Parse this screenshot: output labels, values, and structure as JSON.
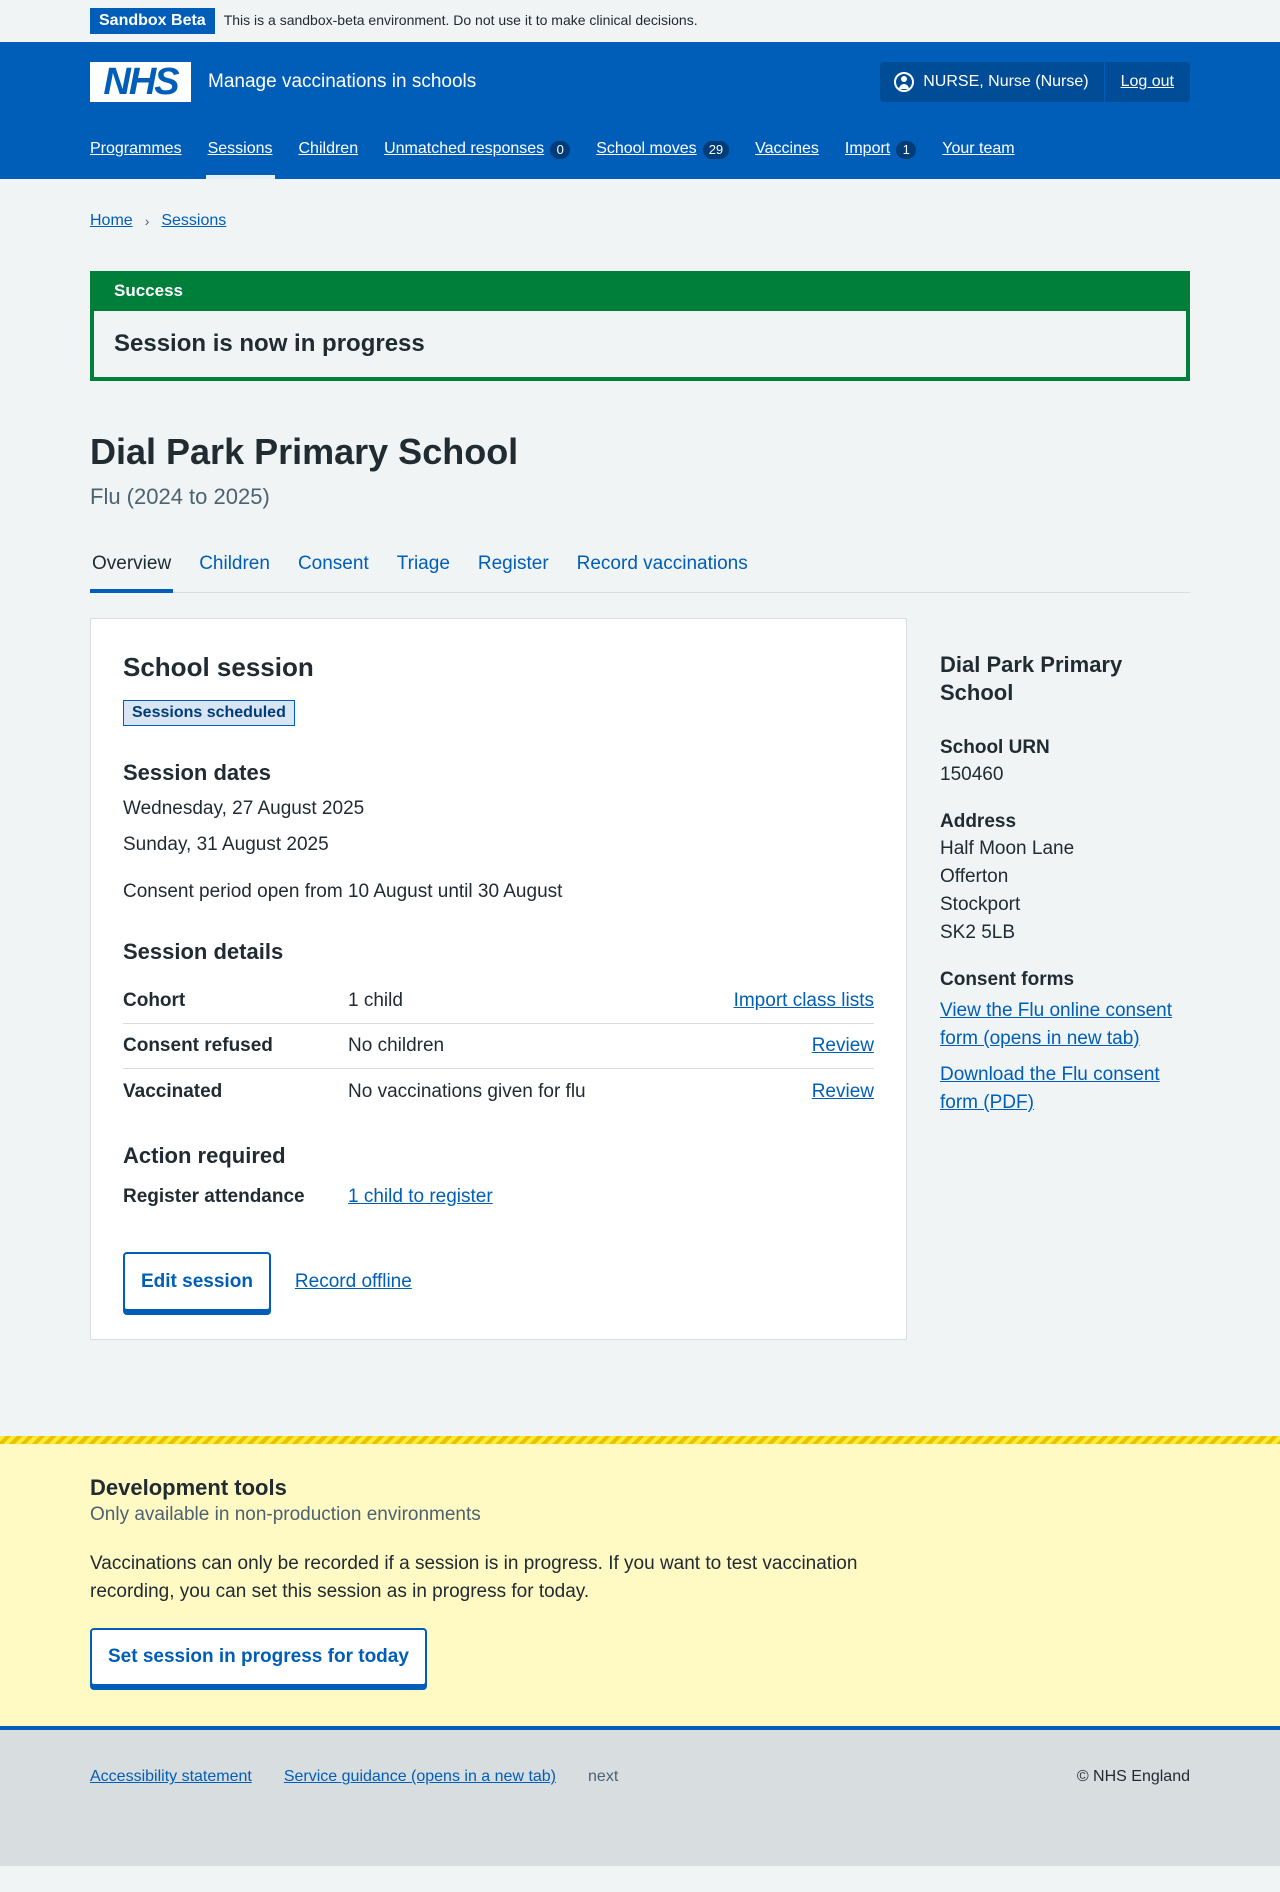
{
  "sandbox": {
    "tag": "Sandbox Beta",
    "message": "This is a sandbox-beta environment. Do not use it to make clinical decisions."
  },
  "header": {
    "logo_text": "NHS",
    "service_name": "Manage vaccinations in schools",
    "user": "NURSE, Nurse (Nurse)",
    "logout": "Log out"
  },
  "nav": [
    {
      "label": "Programmes",
      "count": null
    },
    {
      "label": "Sessions",
      "count": null,
      "active": true
    },
    {
      "label": "Children",
      "count": null
    },
    {
      "label": "Unmatched responses",
      "count": "0"
    },
    {
      "label": "School moves",
      "count": "29"
    },
    {
      "label": "Vaccines",
      "count": null
    },
    {
      "label": "Import",
      "count": "1"
    },
    {
      "label": "Your team",
      "count": null
    }
  ],
  "breadcrumb": [
    "Home",
    "Sessions"
  ],
  "success": {
    "title": "Success",
    "message": "Session is now in progress"
  },
  "page": {
    "title": "Dial Park Primary School",
    "caption": "Flu (2024 to 2025)"
  },
  "tabs": [
    "Overview",
    "Children",
    "Consent",
    "Triage",
    "Register",
    "Record vaccinations"
  ],
  "card": {
    "heading": "School session",
    "status_tag": "Sessions scheduled",
    "dates_heading": "Session dates",
    "dates": [
      "Wednesday, 27 August 2025",
      "Sunday, 31 August 2025"
    ],
    "consent_period": "Consent period open from 10 August until 30 August",
    "details_heading": "Session details",
    "details": [
      {
        "key": "Cohort",
        "value": "1 child",
        "action": "Import class lists"
      },
      {
        "key": "Consent refused",
        "value": "No children",
        "action": "Review"
      },
      {
        "key": "Vaccinated",
        "value": "No vaccinations given for flu",
        "action": "Review"
      }
    ],
    "action_heading": "Action required",
    "action_key": "Register attendance",
    "action_link": "1 child to register",
    "edit_button": "Edit session",
    "offline_link": "Record offline"
  },
  "aside": {
    "heading": "Dial Park Primary School",
    "urn_label": "School URN",
    "urn": "150460",
    "address_label": "Address",
    "address": [
      "Half Moon Lane",
      "Offerton",
      "Stockport",
      "SK2 5LB"
    ],
    "consent_label": "Consent forms",
    "links": [
      "View the Flu online consent form (opens in new tab)",
      "Download the Flu consent form (PDF)"
    ]
  },
  "devtools": {
    "heading": "Development tools",
    "sub": "Only available in non-production environments",
    "description": "Vaccinations can only be recorded if a session is in progress. If you want to test vaccination recording, you can set this session as in progress for today.",
    "button": "Set session in progress for today"
  },
  "footer": {
    "links": [
      "Accessibility statement",
      "Service guidance (opens in a new tab)"
    ],
    "meta": "next",
    "copyright": "© NHS England"
  },
  "colors": {
    "nhs_blue": "#005eb8",
    "success_green": "#007f3b",
    "devtools_yellow": "#fff9c4"
  }
}
